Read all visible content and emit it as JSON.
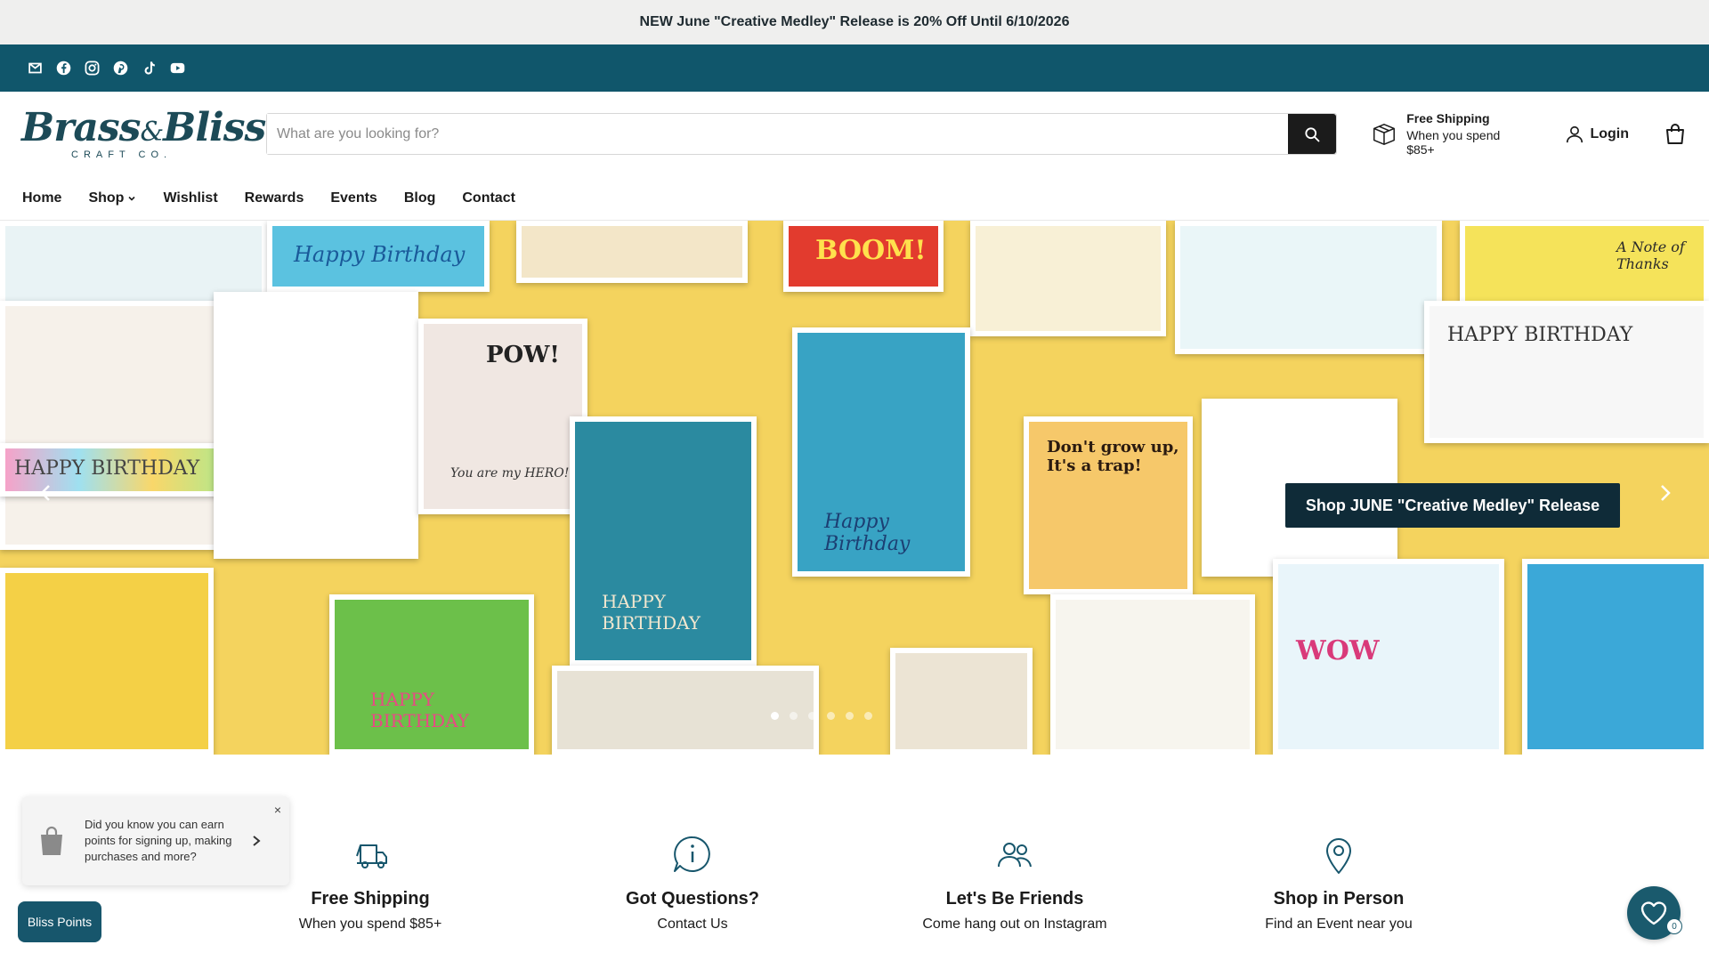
{
  "announcement": "NEW June \"Creative Medley\" Release is 20% Off Until 6/10/2026",
  "social_icons": [
    "email-icon",
    "facebook-icon",
    "instagram-icon",
    "pinterest-icon",
    "tiktok-icon",
    "youtube-icon"
  ],
  "brand": {
    "logo_text": "Brass",
    "logo_amp": "&",
    "logo_text2": "Bliss",
    "logo_sub": "CRAFT CO."
  },
  "search": {
    "placeholder": "What are you looking for?"
  },
  "shipping": {
    "title": "Free Shipping",
    "subtitle": "When you spend $85+"
  },
  "login_label": "Login",
  "nav": [
    "Home",
    "Shop",
    "Wishlist",
    "Rewards",
    "Events",
    "Blog",
    "Contact"
  ],
  "hero": {
    "cta": "Shop JUNE \"Creative Medley\" Release",
    "card_texts": [
      "Happy Birthday",
      "HAPPY BIRTHDAY",
      "You are my HERO!",
      "Don't grow up, It's a trap!",
      "A Note of Thanks",
      "POW!",
      "WOW",
      "BOOM!",
      "Happy Birthday"
    ],
    "slide_count": 6,
    "active_slide": 1
  },
  "features": [
    {
      "icon": "truck-icon",
      "title": "Free Shipping",
      "subtitle": "When you spend $85+"
    },
    {
      "icon": "info-bubble-icon",
      "title": "Got Questions?",
      "subtitle": "Contact Us"
    },
    {
      "icon": "users-icon",
      "title": "Let's Be Friends",
      "subtitle": "Come hang out on Instagram"
    },
    {
      "icon": "map-pin-icon",
      "title": "Shop in Person",
      "subtitle": "Find an Event near you"
    }
  ],
  "popup": {
    "text": "Did you know you can earn points for signing up, making purchases and more?",
    "close": "×"
  },
  "bliss_points": "Bliss Points",
  "wishlist_count": "0",
  "colors": {
    "teal": "#10566b",
    "dark": "#0f2b38",
    "announce_bg": "#efefee"
  }
}
